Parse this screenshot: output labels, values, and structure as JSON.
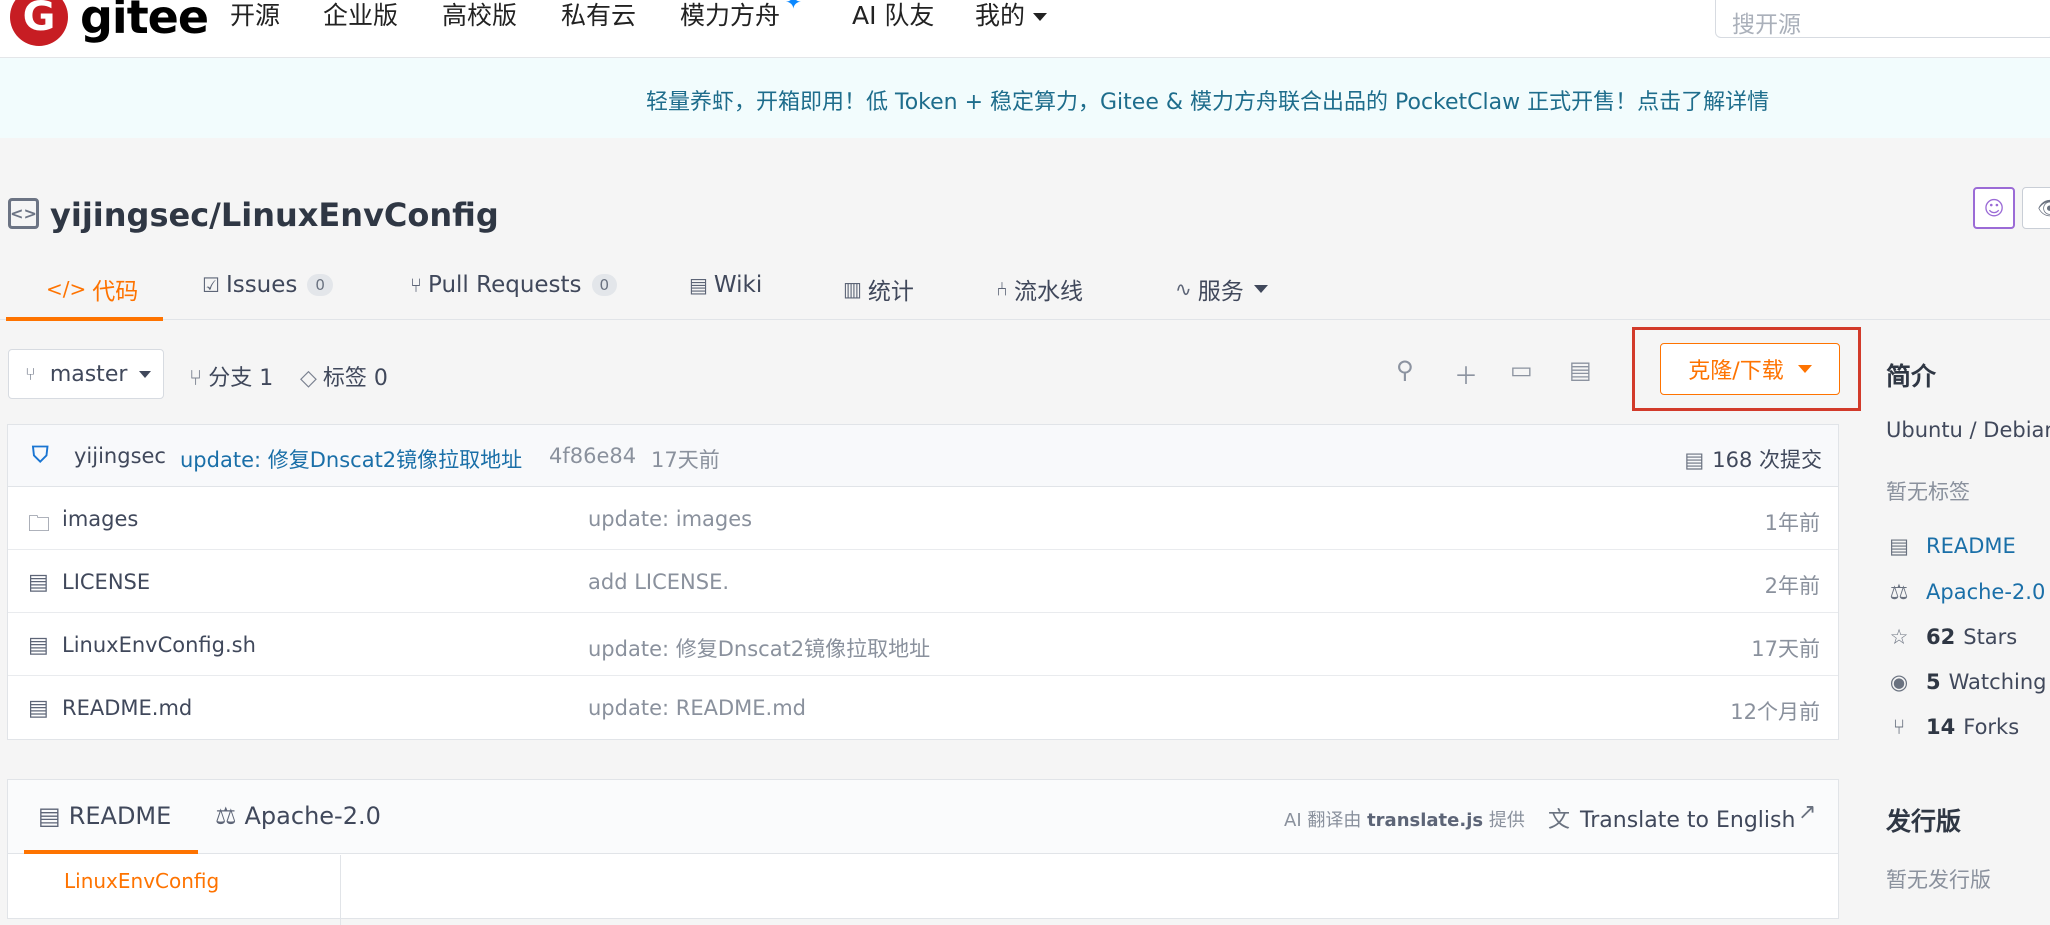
{
  "nav": {
    "logo_text": "gitee",
    "items": [
      "开源",
      "企业版",
      "高校版",
      "私有云",
      "模力方舟",
      "AI 队友",
      "我的"
    ],
    "search_placeholder": "搜开源"
  },
  "banner": {
    "text": "轻量养虾，开箱即用！低 Token + 稳定算力，Gitee & 模力方舟联合出品的 PocketClaw 正式开售！点击了解详情"
  },
  "repo": {
    "title": "yijingsec/LinuxEnvConfig"
  },
  "tabs": [
    {
      "label": "代码",
      "count": null
    },
    {
      "label": "Issues",
      "count": "0"
    },
    {
      "label": "Pull Requests",
      "count": "0"
    },
    {
      "label": "Wiki",
      "count": null
    },
    {
      "label": "统计",
      "count": null
    },
    {
      "label": "流水线",
      "count": null
    },
    {
      "label": "服务",
      "count": null
    }
  ],
  "toolbar": {
    "branch": "master",
    "branches_label": "分支 1",
    "tags_label": "标签 0",
    "clone_label": "克隆/下载"
  },
  "commit": {
    "author": "yijingsec",
    "message": "update: 修复Dnscat2镜像拉取地址",
    "hash": "4f86e84",
    "time": "17天前",
    "count_label": "168 次提交"
  },
  "files": [
    {
      "name": "images",
      "type": "folder",
      "message": "update: images",
      "time": "1年前"
    },
    {
      "name": "LICENSE",
      "type": "file",
      "message": "add LICENSE.",
      "time": "2年前"
    },
    {
      "name": "LinuxEnvConfig.sh",
      "type": "file",
      "message": "update: 修复Dnscat2镜像拉取地址",
      "time": "17天前"
    },
    {
      "name": "README.md",
      "type": "file",
      "message": "update: README.md",
      "time": "12个月前"
    }
  ],
  "readme": {
    "tab_readme": "README",
    "tab_license": "Apache-2.0",
    "translate_prefix": "AI 翻译由",
    "translate_brand": "translate.js",
    "translate_suffix": "提供",
    "translate_button": "Translate to English",
    "toc_first": "LinuxEnvConfig"
  },
  "sidebar": {
    "intro_heading": "简介",
    "description": "Ubuntu / Debian",
    "no_tags": "暂无标签",
    "readme_link": "README",
    "license_link": "Apache-2.0",
    "stars_num": "62",
    "stars_label": "Stars",
    "watching_num": "5",
    "watching_label": "Watching",
    "forks_num": "14",
    "forks_label": "Forks",
    "release_heading": "发行版",
    "no_release": "暂无发行版"
  },
  "colors": {
    "accent": "#fe7300",
    "link": "#1a6fa8",
    "highlight_border": "#d23a2a",
    "logo": "#c71d23"
  }
}
